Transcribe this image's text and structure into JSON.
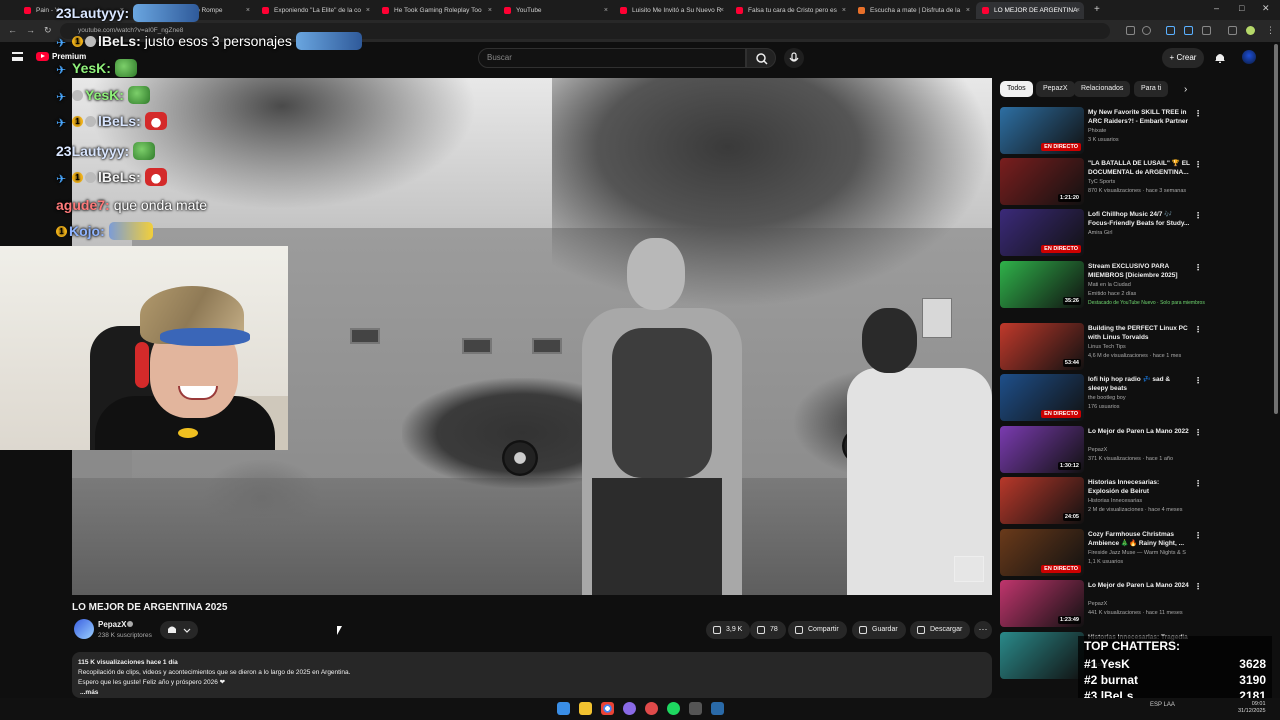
{
  "browser": {
    "tabs": [
      {
        "label": "Pain - Y",
        "active": false
      },
      {
        "label": "Cuando el Pueblo Rompe",
        "active": false
      },
      {
        "label": "Exponiendo \"La Elite\" de la co",
        "active": false
      },
      {
        "label": "He Took Gaming Roleplay Too",
        "active": false
      },
      {
        "label": "YouTube",
        "active": false
      },
      {
        "label": "Luisito Me Invitó a Su Nuevo R",
        "active": false
      },
      {
        "label": "Falsa tu cara de Cristo pero es",
        "active": false
      },
      {
        "label": "Escucha a mate | Disfruta de la",
        "active": false
      },
      {
        "label": "LO MEJOR DE ARGENTINA",
        "active": true
      }
    ],
    "new_tab": "+",
    "url": "youtube.com/watch?v=aI0F_ngZne8",
    "window_controls": [
      "–",
      "□",
      "✕"
    ]
  },
  "youtube": {
    "logo_label": "Premium",
    "search_placeholder": "Buscar",
    "create_label": "Crear",
    "icons": [
      "menu-icon",
      "youtube-logo-icon",
      "search-icon",
      "mic-icon",
      "bell-icon",
      "avatar"
    ]
  },
  "chat": [
    {
      "user": "23Lautyyy",
      "message": "",
      "color": "uname-pale",
      "badges": [],
      "emote": "wide"
    },
    {
      "user": "lBeLs",
      "message": "justo esos 3 personajes",
      "color": "uname-white",
      "badges": [
        "pin",
        "gold",
        "grey"
      ],
      "emote": "wide"
    },
    {
      "user": "YesK",
      "message": "",
      "color": "uname-green",
      "badges": [
        "pin"
      ],
      "emote": "pepe"
    },
    {
      "user": "YesK",
      "message": "",
      "color": "uname-green",
      "badges": [
        "pin",
        "grey"
      ],
      "emote": "pepe"
    },
    {
      "user": "lBeLs",
      "message": "",
      "color": "uname-pale",
      "badges": [
        "pin",
        "gold",
        "grey"
      ],
      "emote": "santa"
    },
    {
      "user": "23Lautyyy",
      "message": "",
      "color": "uname-pale",
      "badges": [],
      "emote": "pepe"
    },
    {
      "user": "lBeLs",
      "message": "",
      "color": "uname-white",
      "badges": [
        "pin",
        "gold",
        "grey"
      ],
      "emote": "santa"
    },
    {
      "user": "agude7",
      "message": "que onda mate",
      "color": "uname-red",
      "badges": [],
      "emote": ""
    },
    {
      "user": "Kojo",
      "message": "",
      "color": "uname-blue",
      "badges": [
        "gold"
      ],
      "emote": "duck"
    }
  ],
  "video": {
    "title": "LO MEJOR DE ARGENTINA 2025",
    "channel": "PepazX",
    "subscribers": "238 K suscriptores",
    "likes": "3,9 K",
    "dislikes": "78",
    "share": "Compartir",
    "save": "Guardar",
    "download": "Descargar",
    "more": "···",
    "desc_meta": "115 K visualizaciones  hace 1 día",
    "desc_line1": "Recopilación de clips, videos y acontecimientos que se dieron a lo largo de 2025 en Argentina.",
    "desc_line2": "Espero que les guste! Feliz año y próspero 2026 ❤",
    "desc_more": "...más"
  },
  "chips": [
    "Todos",
    "PepazX",
    "Relacionados",
    "Para ti"
  ],
  "recommendations": [
    {
      "title": "My New Favorite SKILL TREE in ARC Raiders?! - Embark Partner",
      "channel": "Phixate",
      "stats": "3 K usuarios",
      "badge": "EN DIRECTO",
      "badge_type": "live",
      "thumb": "#2d6fa3",
      "extra": ""
    },
    {
      "title": "\"LA BATALLA DE LUSAIL\" 🏆 EL DOCUMENTAL de ARGENTINA...",
      "channel": "TyC Sports",
      "stats": "870 K visualizaciones · hace 3 semanas",
      "badge": "1:21:20",
      "badge_type": "dur",
      "thumb": "#7a1e1e",
      "extra": ""
    },
    {
      "title": "Lofi Chillhop Music 24/7 🎶 Focus-Friendly Beats for Study...",
      "channel": "Amira Girl",
      "stats": "",
      "badge": "EN DIRECTO",
      "badge_type": "live",
      "thumb": "#3b2a7a",
      "extra": ""
    },
    {
      "title": "Stream EXCLUSIVO PARA MIEMBROS [Diciembre 2025]",
      "channel": "Mati en la Ciudad",
      "stats": "Emitido hace 2 días",
      "badge": "35:26",
      "badge_type": "dur",
      "thumb": "#2fb24a",
      "extra": "Destacado de YouTube  Nuevo  ·  Solo para miembros"
    },
    {
      "title": "Building the PERFECT Linux PC with Linus Torvalds",
      "channel": "Linus Tech Tips",
      "stats": "4,6 M de visualizaciones · hace 1 mes",
      "badge": "53:44",
      "badge_type": "dur",
      "thumb": "#c0392b",
      "extra": ""
    },
    {
      "title": "lofi hip hop radio 💤 sad & sleepy beats",
      "channel": "the bootleg boy",
      "stats": "176 usuarios",
      "badge": "EN DIRECTO",
      "badge_type": "live",
      "thumb": "#1e4f8a",
      "extra": ""
    },
    {
      "title": "Lo Mejor de Paren La Mano 2022",
      "channel": "PepazX",
      "stats": "371 K visualizaciones · hace 1 año",
      "badge": "1:30:12",
      "badge_type": "dur",
      "thumb": "#7a3bb0",
      "extra": ""
    },
    {
      "title": "Historias Innecesarias: Explosión de Beirut",
      "channel": "Historias Innecesarias",
      "stats": "2 M de visualizaciones · hace 4 meses",
      "badge": "24:05",
      "badge_type": "dur",
      "thumb": "#b8382a",
      "extra": ""
    },
    {
      "title": "Cozy Farmhouse Christmas Ambience 🎄🔥 Rainy Night, ...",
      "channel": "Fireside Jazz Muse — Warm Nights & S",
      "stats": "1,1 K usuarios",
      "badge": "EN DIRECTO",
      "badge_type": "live",
      "thumb": "#6a3a1a",
      "extra": ""
    },
    {
      "title": "Lo Mejor de Paren La Mano 2024",
      "channel": "PepazX",
      "stats": "441 K visualizaciones · hace 11 meses",
      "badge": "1:23:49",
      "badge_type": "dur",
      "thumb": "#c0356d",
      "extra": ""
    },
    {
      "title": "Historias Innecesarias: Tragedia",
      "channel": "",
      "stats": "· hace 1 año",
      "badge": "",
      "badge_type": "",
      "thumb": "#2a8a8a",
      "extra": ""
    }
  ],
  "top_chatters": {
    "title": "TOP CHATTERS:",
    "rows": [
      {
        "rank": "#1",
        "name": "YesK",
        "count": "3628"
      },
      {
        "rank": "#2",
        "name": "burnat",
        "count": "3190"
      },
      {
        "rank": "#3",
        "name": "lBeLs",
        "count": "2181"
      }
    ]
  },
  "taskbar": {
    "tray": "ESP LAA",
    "time": "09:01",
    "date": "31/12/2025"
  }
}
